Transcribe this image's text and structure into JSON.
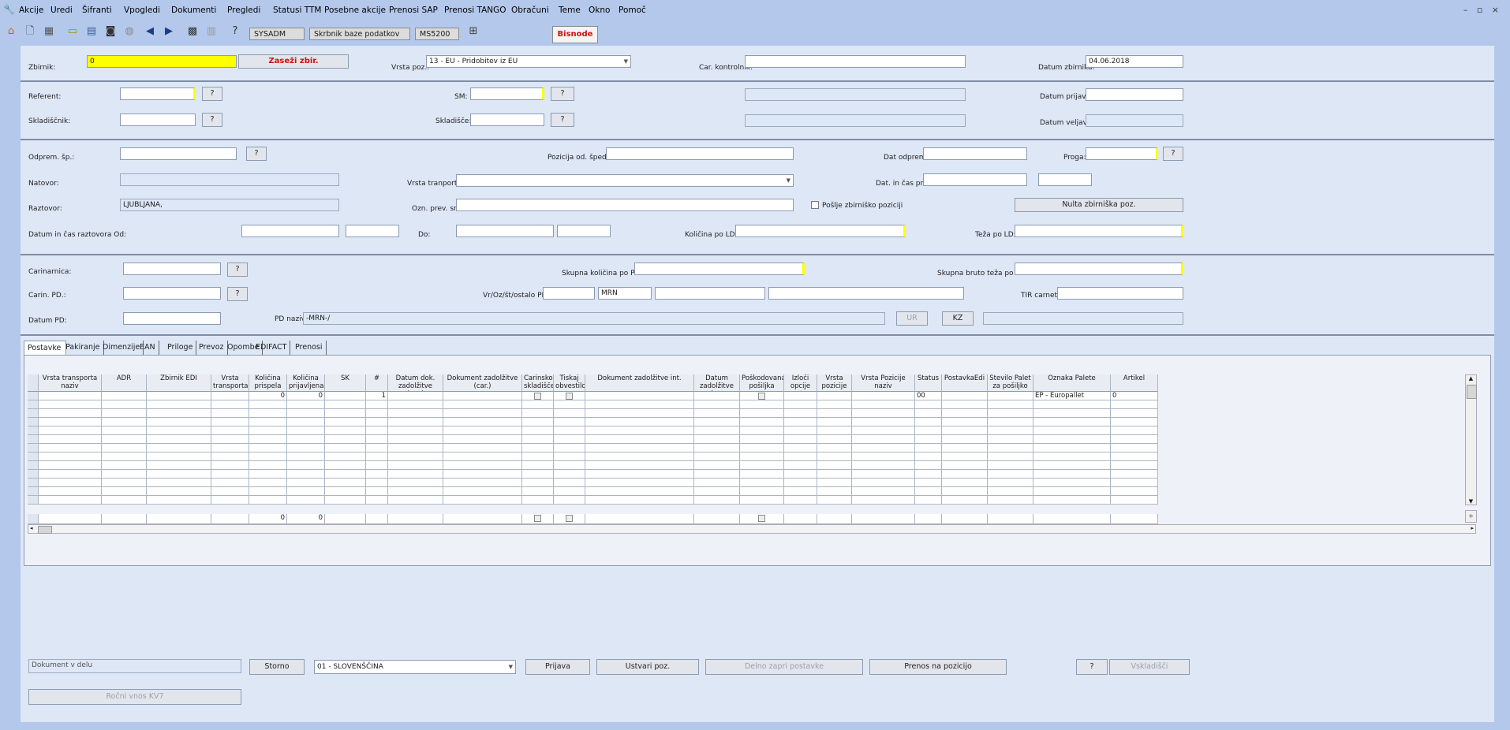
{
  "menu": {
    "items": [
      "Akcije",
      "Uredi",
      "Šifranti",
      "Vpogledi",
      "Dokumenti",
      "Pregledi",
      "Statusi TTM",
      "Posebne akcije",
      "Prenosi SAP",
      "Prenosi TANGO",
      "Obračuni",
      "Teme",
      "Okno",
      "Pomoč"
    ],
    "window_controls": "– ▫ ×"
  },
  "toolbar": {
    "user": "SYSADM",
    "role": "Skrbnik baze podatkov",
    "code": "MS5200",
    "brand": "Bisnode"
  },
  "header": {
    "zbirnik_label": "Zbirnik:",
    "zbirnik_value": "0",
    "zasezi_button": "Zaseži zbir.",
    "vrsta_poz_label": "Vrsta poz.:",
    "vrsta_poz_value": "13 - EU - Pridobitev iz EU",
    "car_kontrolnik_label": "Car. kontrolnik:",
    "datum_zbirnika_label": "Datum zbirnika:",
    "datum_zbirnika_value": "04.06.2018"
  },
  "section2": {
    "referent_label": "Referent:",
    "sm_label": "SM:",
    "datum_prijave_label": "Datum prijave:",
    "skladiscnik_label": "Skladiščnik:",
    "skladisce_label": "Skladišče:",
    "datum_veljav_label": "Datum veljav.:",
    "q": "?"
  },
  "section3": {
    "odprem_label": "Odprem. šp.:",
    "pozicija_label": "Pozicija od. šped.:",
    "dat_odpreme_label": "Dat odpreme:",
    "proga_label": "Proga:",
    "natovor_label": "Natovor:",
    "vrsta_tranporta_label": "Vrsta tranporta:",
    "dat_cas_prih_label": "Dat. in čas prih.:",
    "raztovor_label": "Raztovor:",
    "raztovor_value": "LJUBLJANA,",
    "ozn_prev_label": "Ozn. prev. sr.:",
    "poslje_label": "Pošlje zbirniško poziciji",
    "nulta_button": "Nulta zbirniška poz.",
    "datum_cas_label": "Datum in čas raztovora Od:",
    "do_label": "Do:",
    "kolicina_ld_label": "Količina po LD:",
    "teza_ld_label": "Teža po LD:"
  },
  "section4": {
    "carinarnica_label": "Carinarnica:",
    "skupna_kolicina_label": "Skupna količina po PD:",
    "skupna_bruto_label": "Skupna bruto teža po PD:",
    "carin_pd_label": "Carin. PD.:",
    "vr_oz_label": "Vr/Oz/št/ostalo PD:",
    "mrn_value": "MRN",
    "tir_label": "TIR carnet:",
    "datum_pd_label": "Datum PD:",
    "pd_naziv_label": "PD naziv:",
    "pd_naziv_value": "-MRN-/",
    "ur_button": "UR",
    "kz_button": "KZ"
  },
  "tabs": [
    "Postavke",
    "Pakiranje",
    "Dimenzije",
    "EAN",
    "Priloge",
    "Prevoz",
    "Opombe",
    "EDIFACT",
    "Prenosi"
  ],
  "grid": {
    "columns": [
      "Vrsta transporta naziv",
      "ADR",
      "Zbirnik EDI",
      "Vrsta transporta",
      "Količina prispela",
      "Količina prijavljena",
      "SK",
      "#",
      "Datum dok. zadolžitve (car.)",
      "Dokument zadolžitve (car.)",
      "Carinsko skladišče",
      "Tiskaj obvestilo",
      "Dokument zadolžitve int.",
      "Datum zadolžitve int.",
      "Poškodovana pošiljka",
      "Izloči opcije vt.",
      "Vrsta pozicije",
      "Vrsta Pozicije naziv",
      "Status",
      "PostavkaEdi",
      "Število Palet za pošiljko",
      "Oznaka Palete",
      "Artikel"
    ],
    "row1": {
      "kolicina_prispela": "0",
      "kolicina_prijavljena": "0",
      "num": "1",
      "status": "00",
      "oznaka_palete": "EP - Europallet",
      "artikel": "0"
    },
    "totals": {
      "kolicina_prispela": "0",
      "kolicina_prijavljena": "0"
    }
  },
  "footer": {
    "status_text": "Dokument v delu",
    "storno_button": "Storno",
    "language_value": "01 - SLOVENŠČINA",
    "prijava_button": "Prijava",
    "ustvari_button": "Ustvari poz.",
    "delno_button": "Delno zapri postavke",
    "prenos_button": "Prenos na pozicijo",
    "help_button": "?",
    "vskladisci_button": "Vskladišči",
    "rocni_button": "Ročni vnos KV7"
  }
}
